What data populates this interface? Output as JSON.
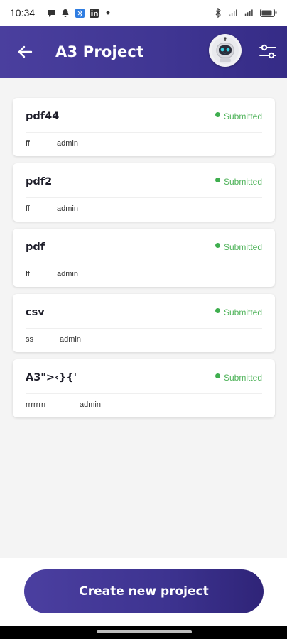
{
  "status_bar": {
    "time": "10:34",
    "icons_left": [
      "chat-icon",
      "notification-bell-icon",
      "bluetooth-app-icon",
      "linkedin-icon",
      "dot-icon"
    ],
    "icons_right": [
      "bluetooth-icon",
      "signal-icon",
      "wifi-signal-icon",
      "battery-icon"
    ]
  },
  "app_bar": {
    "title": "A3 Project",
    "back_icon": "back-arrow-icon",
    "avatar_icon": "robot-avatar-icon",
    "filter_icon": "filter-sliders-icon",
    "background": "#4a3f9e"
  },
  "projects": [
    {
      "name": "pdf44",
      "status": "Submitted",
      "type": "ff",
      "owner": "admin"
    },
    {
      "name": "pdf2",
      "status": "Submitted",
      "type": "ff",
      "owner": "admin"
    },
    {
      "name": "pdf",
      "status": "Submitted",
      "type": "ff",
      "owner": "admin"
    },
    {
      "name": "csv",
      "status": "Submitted",
      "type": "ss",
      "owner": "admin"
    },
    {
      "name": "A3\">‹}{'",
      "status": "Submitted",
      "type": "rrrrrrrr",
      "owner": "admin"
    }
  ],
  "colors": {
    "status_submitted": "#4fb35a",
    "accent": "#3f3592"
  },
  "actions": {
    "create_label": "Create new project"
  }
}
